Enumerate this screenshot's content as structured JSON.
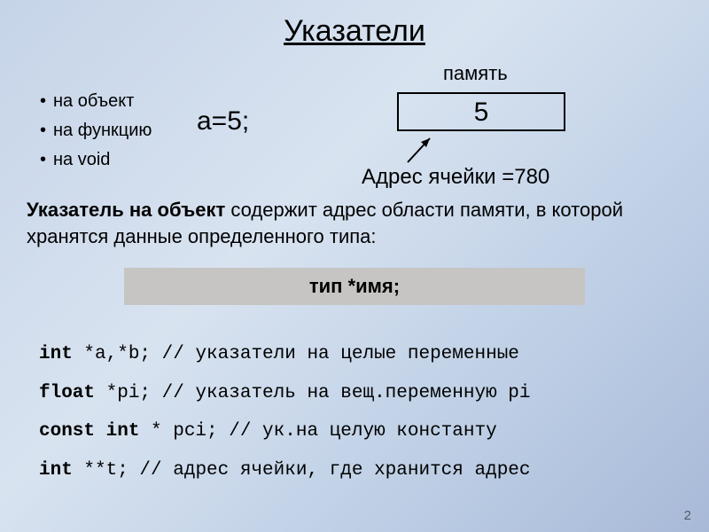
{
  "title": "Указатели",
  "memory_label": "память",
  "bullets": [
    "на объект",
    "на функцию",
    "на void"
  ],
  "assign": "a=5;",
  "cell_value": "5",
  "cell_addr": "Адрес ячейки =780",
  "definition_lead": "Указатель на объект",
  "definition_rest": " содержит адрес области памяти, в которой хранятся данные определенного типа:",
  "syntax_bar": "тип *имя;",
  "code_lines": [
    {
      "kw": "int",
      "decl": " *a,*b;",
      "comment": " // указатели на целые переменные"
    },
    {
      "kw": "float",
      "decl": " *pi;",
      "comment": " // указатель на вещ.переменную pi"
    },
    {
      "kw": "const int",
      "decl": " * pci;",
      "comment": " // ук.на целую константу"
    },
    {
      "kw": "int",
      "decl": " **t;",
      "comment": " // адрес ячейки, где хранится адрес"
    }
  ],
  "page_number": "2"
}
